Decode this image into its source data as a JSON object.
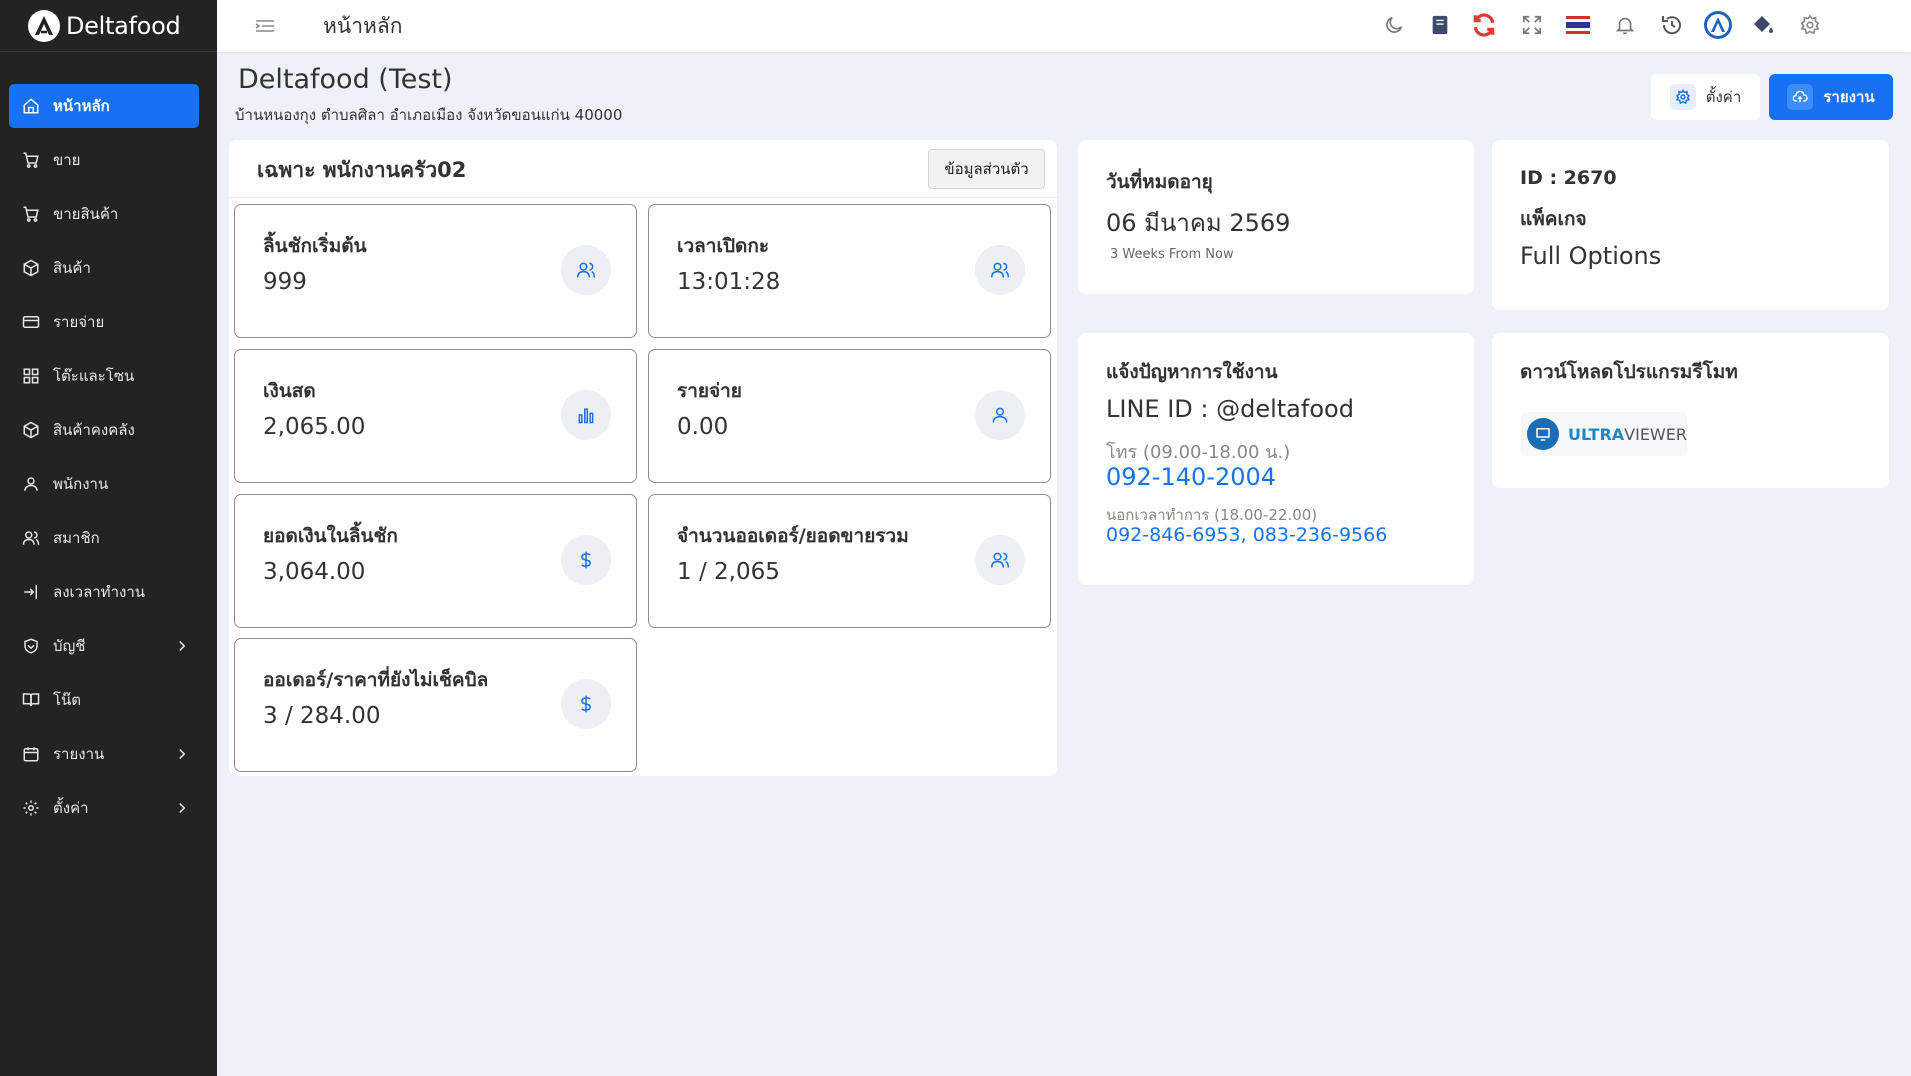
{
  "brand": {
    "name": "Deltafood"
  },
  "topbar": {
    "title": "หน้าหลัก",
    "icons": [
      "moon-icon",
      "book-icon",
      "sync-icon",
      "fullscreen-icon",
      "thai-flag-icon",
      "bell-icon",
      "history-icon",
      "user-avatar-icon",
      "paint-bucket-icon",
      "gear-icon"
    ]
  },
  "sidebar": {
    "items": [
      {
        "label": "หน้าหลัก",
        "icon": "home-icon",
        "active": true
      },
      {
        "label": "ขาย",
        "icon": "cart-icon"
      },
      {
        "label": "ขายสินค้า",
        "icon": "cart-icon"
      },
      {
        "label": "สินค้า",
        "icon": "box-icon"
      },
      {
        "label": "รายจ่าย",
        "icon": "credit-card-icon"
      },
      {
        "label": "โต๊ะและโซน",
        "icon": "grid-icon"
      },
      {
        "label": "สินค้าคงคลัง",
        "icon": "box-icon"
      },
      {
        "label": "พนักงาน",
        "icon": "user-icon"
      },
      {
        "label": "สมาชิก",
        "icon": "users-icon"
      },
      {
        "label": "ลงเวลาทำงาน",
        "icon": "login-icon"
      },
      {
        "label": "บัญชี",
        "icon": "shield-icon",
        "submenu": true
      },
      {
        "label": "โน๊ต",
        "icon": "open-book-icon"
      },
      {
        "label": "รายงาน",
        "icon": "calendar-icon",
        "submenu": true
      },
      {
        "label": "ตั้งค่า",
        "icon": "gear-icon",
        "submenu": true
      }
    ]
  },
  "header": {
    "title": "Deltafood (Test)",
    "address": "บ้านหนองกุง ตำบลศิลา อำเภอเมือง จังหวัดขอนแก่น 40000",
    "settings_label": "ตั้งค่า",
    "report_label": "รายงาน"
  },
  "panel": {
    "title": "เฉพาะ พนักงานครัว02",
    "profile_button": "ข้อมูลส่วนตัว",
    "stats": [
      {
        "label": "ลิ้นชักเริ่มต้น",
        "value": "999",
        "icon": "users-icon"
      },
      {
        "label": "เวลาเปิดกะ",
        "value": "13:01:28",
        "icon": "users-icon"
      },
      {
        "label": "เงินสด",
        "value": "2,065.00",
        "icon": "bar-chart-icon"
      },
      {
        "label": "รายจ่าย",
        "value": "0.00",
        "icon": "user-icon"
      },
      {
        "label": "ยอดเงินในลิ้นชัก",
        "value": "3,064.00",
        "icon": "dollar-icon"
      },
      {
        "label": "จำนวนออเดอร์/ยอดขายรวม",
        "value": "1 / 2,065",
        "icon": "users-icon"
      },
      {
        "label": "ออเดอร์/ราคาที่ยังไม่เช็คบิล",
        "value": "3 / 284.00",
        "icon": "dollar-icon"
      }
    ]
  },
  "expiry": {
    "label": "วันที่หมดอายุ",
    "date": "06 มีนาคม 2569",
    "relative": "3 Weeks From Now"
  },
  "package": {
    "id": "ID : 2670",
    "label": "แพ็คเกจ",
    "value": "Full Options"
  },
  "support": {
    "label": "แจ้งปัญหาการใช้งาน",
    "line": "LINE ID : @deltafood",
    "phone_hours": "โทร (09.00-18.00 น.)",
    "phone": "092-140-2004",
    "after_hours": "นอกเวลาทำการ (18.00-22.00)",
    "after_phone_1": "092-846-6953",
    "separator": ",",
    "after_phone_2": "083-236-9566"
  },
  "download": {
    "label": "ดาวน์โหลดโปรแกรมรีโมท",
    "app_prefix": "ULTRA",
    "app_suffix": "VIEWER"
  },
  "colors": {
    "accent": "#1672f3",
    "sidebar": "#232323",
    "background": "#eef1f8"
  }
}
